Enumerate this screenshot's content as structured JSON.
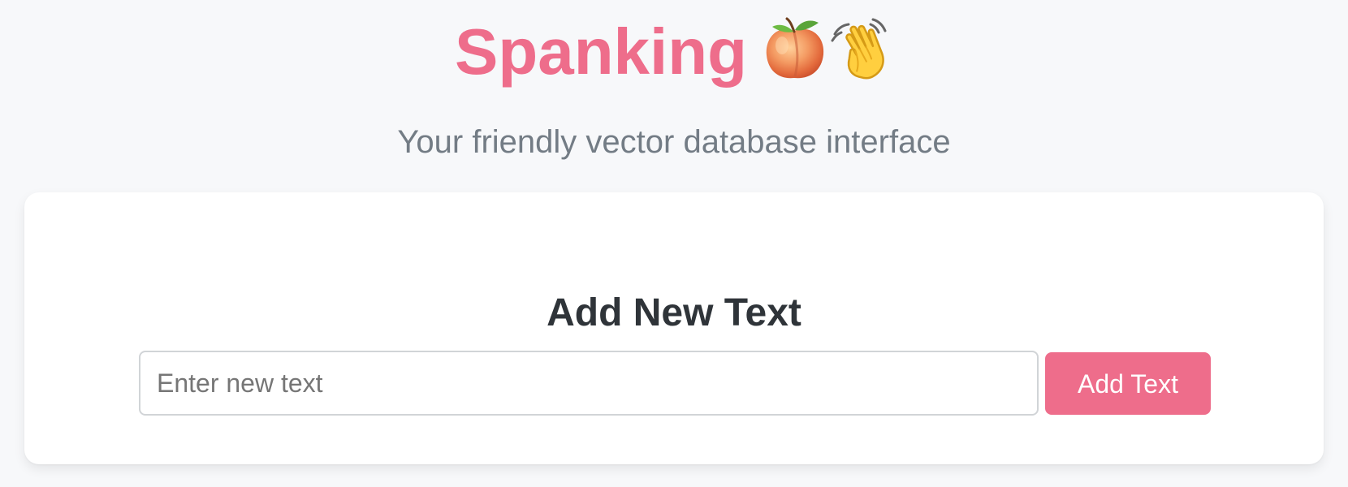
{
  "app": {
    "title": "Spanking",
    "title_icons": [
      "peach-icon",
      "waving-hand-icon"
    ],
    "subtitle": "Your friendly vector database interface",
    "accent_color": "#ee6d8b"
  },
  "add_text_card": {
    "heading": "Add New Text",
    "input": {
      "value": "",
      "placeholder": "Enter new text"
    },
    "button_label": "Add Text"
  }
}
